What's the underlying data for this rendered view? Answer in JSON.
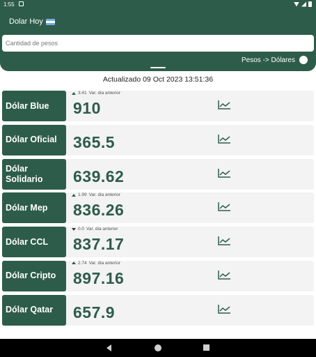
{
  "status_bar": {
    "time": "1:55"
  },
  "app": {
    "title": "Dolar Hoy",
    "flag_icon": "argentina-flag-icon"
  },
  "search": {
    "placeholder": "Cantidad de pesos",
    "value": ""
  },
  "toggle": {
    "label": "Pesos -> Dólares",
    "state": "off"
  },
  "updated_text": "Actualizado 09 Oct 2023 13:51:36",
  "colors": {
    "primary": "#2e5c4b",
    "row_bg": "#f3f3f3",
    "text": "#222222"
  },
  "rows": [
    {
      "name": "Dólar Blue",
      "price": "910",
      "var_dir": "up",
      "var_value": "3.41",
      "var_label": "Var. dia anterior"
    },
    {
      "name": "Dólar Oficial",
      "price": "365.5",
      "var_dir": "",
      "var_value": "",
      "var_label": ""
    },
    {
      "name": "Dólar Solidario",
      "price": "639.62",
      "var_dir": "",
      "var_value": "",
      "var_label": ""
    },
    {
      "name": "Dólar Mep",
      "price": "836.26",
      "var_dir": "up",
      "var_value": "1.99",
      "var_label": "Var. dia anterior"
    },
    {
      "name": "Dólar CCL",
      "price": "837.17",
      "var_dir": "down",
      "var_value": "0.0",
      "var_label": "Var. dia anterior"
    },
    {
      "name": "Dólar Cripto",
      "price": "897.16",
      "var_dir": "up",
      "var_value": "2.74",
      "var_label": "Var. dia anterior"
    },
    {
      "name": "Dólar Qatar",
      "price": "657.9",
      "var_dir": "",
      "var_value": "",
      "var_label": ""
    }
  ]
}
